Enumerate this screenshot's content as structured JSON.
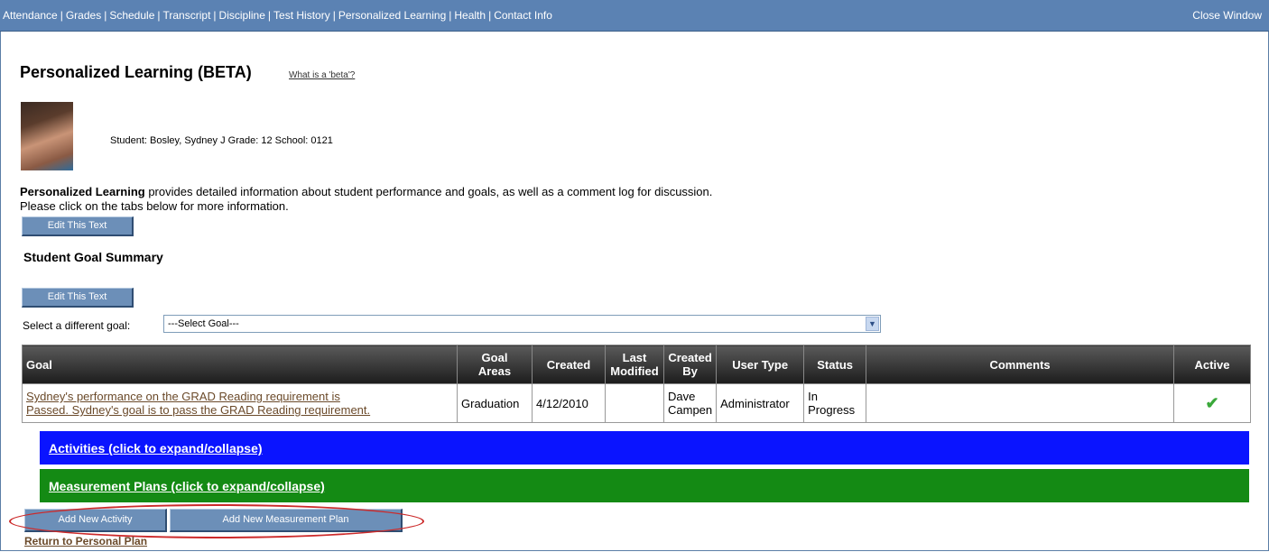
{
  "nav": {
    "items": [
      {
        "label": "Attendance"
      },
      {
        "label": "Grades"
      },
      {
        "label": "Schedule"
      },
      {
        "label": "Transcript"
      },
      {
        "label": "Discipline"
      },
      {
        "label": "Test History"
      },
      {
        "label": "Personalized Learning"
      },
      {
        "label": "Health"
      },
      {
        "label": "Contact Info"
      }
    ],
    "close": "Close Window"
  },
  "page": {
    "title": "Personalized Learning (BETA)",
    "beta_link": "What is a 'beta'?",
    "student_info": "Student: Bosley, Sydney J Grade: 12 School: 0121",
    "intro_bold": "Personalized Learning",
    "intro_rest": " provides detailed information about student performance and goals, as well as a comment log for discussion.",
    "intro_line2": "Please click on the tabs below for more information.",
    "edit_label": "Edit This Text",
    "summary_heading": "Student Goal Summary",
    "select_label": "Select a different goal:",
    "select_value": "---Select Goal---"
  },
  "table": {
    "headers": {
      "goal": "Goal",
      "areas_1": "Goal",
      "areas_2": "Areas",
      "created": "Created",
      "modified_1": "Last",
      "modified_2": "Modified",
      "createdby_1": "Created",
      "createdby_2": "By",
      "usertype": "User Type",
      "status": "Status",
      "comments": "Comments",
      "active": "Active"
    },
    "row": {
      "goal_1": "Sydney's performance on the GRAD Reading requirement is",
      "goal_2": "Passed. Sydney's goal is to pass the GRAD Reading requirement.",
      "areas": "Graduation",
      "created": "4/12/2010",
      "modified": "",
      "createdby_1": "Dave",
      "createdby_2": "Campen",
      "usertype": "Administrator",
      "status_1": "In",
      "status_2": "Progress",
      "comments": "",
      "active_icon": "checkmark-icon",
      "active_glyph": "✔"
    }
  },
  "sections": {
    "activities": "Activities (click to expand/collapse)",
    "measurement": "Measurement Plans (click to expand/collapse)"
  },
  "buttons": {
    "add_activity": "Add New Activity",
    "add_measurement": "Add New Measurement Plan"
  },
  "footer": {
    "return": "Return to Personal Plan"
  },
  "colors": {
    "nav_bg": "#5b82b3",
    "activities_bar": "#0a14ff",
    "measurement_bar": "#148a14",
    "highlight_oval": "#cc2a2a"
  }
}
